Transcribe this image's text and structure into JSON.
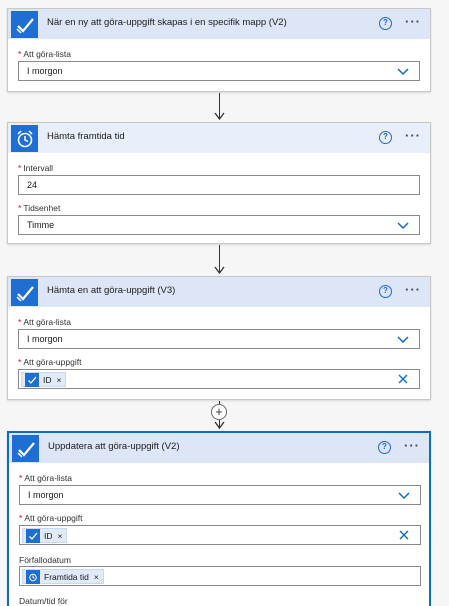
{
  "cards": [
    {
      "title": "När en ny att göra-uppgift skapas i en specifik mapp (V2)",
      "icon": "check-icon",
      "fields": [
        {
          "label": "Att göra-lista",
          "required": true,
          "value": "I morgon",
          "type": "dropdown"
        }
      ]
    },
    {
      "title": "Hämta framtida tid",
      "icon": "alarm-clock-icon",
      "fields": [
        {
          "label": "Intervall",
          "required": true,
          "value": "24",
          "type": "text"
        },
        {
          "label": "Tidsenhet",
          "required": true,
          "value": "Timme",
          "type": "dropdown"
        }
      ]
    },
    {
      "title": "Hämta en att göra-uppgift (V3)",
      "icon": "check-icon",
      "fields": [
        {
          "label": "Att göra-lista",
          "required": true,
          "value": "I morgon",
          "type": "dropdown"
        },
        {
          "label": "Att göra-uppgift",
          "required": true,
          "token": "ID",
          "type": "token"
        }
      ]
    },
    {
      "title": "Uppdatera att göra-uppgift (V2)",
      "icon": "check-icon",
      "fields": [
        {
          "label": "Att göra-lista",
          "required": true,
          "value": "I morgon",
          "type": "dropdown"
        },
        {
          "label": "Att göra-uppgift",
          "required": true,
          "token": "ID",
          "type": "token"
        },
        {
          "label": "Förfallodatum",
          "required": false,
          "token": "Framtida tid",
          "type": "token"
        },
        {
          "label": "Datum/tid för",
          "required": false
        }
      ]
    }
  ],
  "help_glyph": "?",
  "more_glyph": "···",
  "token_remove_glyph": "×",
  "required_mark": "*",
  "add_step_glyph": "+",
  "colors": {
    "accent": "#1f6ed4",
    "header": "#dde6f6",
    "selected_border": "#0f6cbd",
    "required": "#c50f1f"
  }
}
